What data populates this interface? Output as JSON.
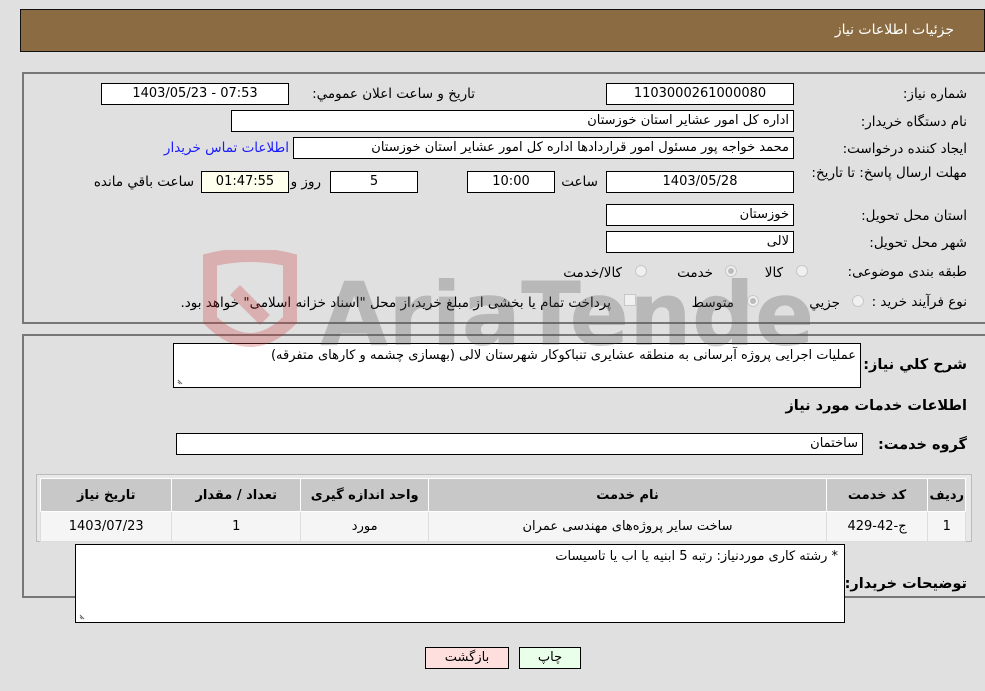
{
  "header": {
    "title": "جزئیات اطلاعات نیاز"
  },
  "fields": {
    "need_number": {
      "label": "شماره نیاز:",
      "value": "1103000261000080"
    },
    "announce_datetime": {
      "label": "تاریخ و ساعت اعلان عمومي:",
      "value": "1403/05/23 - 07:53"
    },
    "buyer_org": {
      "label": "نام دستگاه خریدار:",
      "value": "اداره کل امور عشایر استان خوزستان"
    },
    "requester": {
      "label": "ایجاد کننده درخواست:",
      "value": "محمد خواجه پور مسئول امور قراردادها اداره کل امور عشایر استان خوزستان"
    },
    "buyer_contact_link": "اطلاعات تماس خریدار",
    "deadline": {
      "label": "مهلت ارسال پاسخ: تا تاریخ:",
      "date": "1403/05/28",
      "time_label": "ساعت",
      "time": "10:00",
      "days": "5",
      "days_label": "روز و",
      "remaining": "01:47:55",
      "remaining_label": "ساعت باقي مانده"
    },
    "province": {
      "label": "استان محل تحویل:",
      "value": "خوزستان"
    },
    "city": {
      "label": "شهر محل تحویل:",
      "value": "لالی"
    },
    "category": {
      "label": "طبقه بندی موضوعی:",
      "options": [
        "کالا",
        "خدمت",
        "کالا/خدمت"
      ],
      "selected": "خدمت"
    },
    "purchase_type": {
      "label": "نوع فرآیند خرید :",
      "options": [
        "جزيي",
        "متوسط"
      ],
      "selected": "متوسط",
      "treasury_note": "پرداخت تمام یا بخشی از مبلغ خرید،از محل \"اسناد خزانه اسلامی\" خواهد بود."
    }
  },
  "description": {
    "label": "شرح کلي نیاز:",
    "value": "عملیات اجرایی پروژه آبرسانی به منطقه عشایری  تنباکوکار  شهرستان لالی (بهسازی چشمه و کارهای متفرقه)"
  },
  "services": {
    "section_title": "اطلاعات خدمات مورد نیاز",
    "group_label": "گروه خدمت:",
    "group_value": "ساختمان",
    "table": {
      "headers": [
        "ردیف",
        "کد خدمت",
        "نام خدمت",
        "واحد اندازه گیری",
        "تعداد / مقدار",
        "تاریخ نیاز"
      ],
      "rows": [
        [
          "1",
          "ج-42-429",
          "ساخت سایر پروژه‌های مهندسی عمران",
          "مورد",
          "1",
          "1403/07/23"
        ]
      ]
    }
  },
  "buyer_notes": {
    "label": "توضیحات خریدار:",
    "value": "* رشته کاری موردنیاز:   رتبه 5 ابنیه یا اب یا تاسیسات"
  },
  "buttons": {
    "print": "چاپ",
    "back": "بازگشت"
  },
  "colors": {
    "header_bg": "#8b6b42",
    "print_bg": "#eaffea",
    "back_bg": "#ffdede",
    "remaining_bg": "#ffffee"
  }
}
